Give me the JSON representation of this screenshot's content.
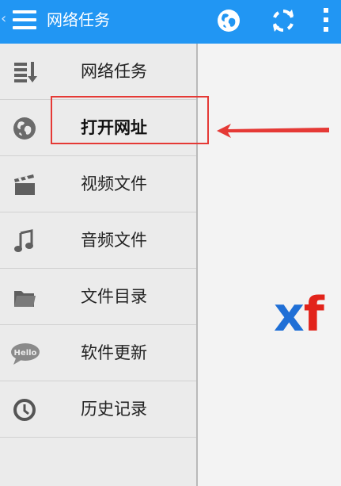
{
  "appbar": {
    "back_glyph": "‹",
    "title": "网络任务",
    "icons": [
      "menu-icon",
      "globe-icon",
      "refresh-icon",
      "overflow-menu-icon"
    ],
    "color": "#2196f3"
  },
  "drawer": {
    "items": [
      {
        "label": "网络任务",
        "icon": "task-list-icon"
      },
      {
        "label": "打开网址",
        "icon": "globe-icon",
        "active": true
      },
      {
        "label": "视频文件",
        "icon": "film-clapper-icon"
      },
      {
        "label": "音频文件",
        "icon": "music-note-icon"
      },
      {
        "label": "文件目录",
        "icon": "folder-icon"
      },
      {
        "label": "软件更新",
        "icon": "hello-bubble-icon",
        "icon_text": "Hello"
      },
      {
        "label": "历史记录",
        "icon": "clock-icon"
      }
    ]
  },
  "content": {
    "logo_x": "x",
    "logo_f": "f"
  },
  "annotation": {
    "highlight_color": "#e53935"
  }
}
